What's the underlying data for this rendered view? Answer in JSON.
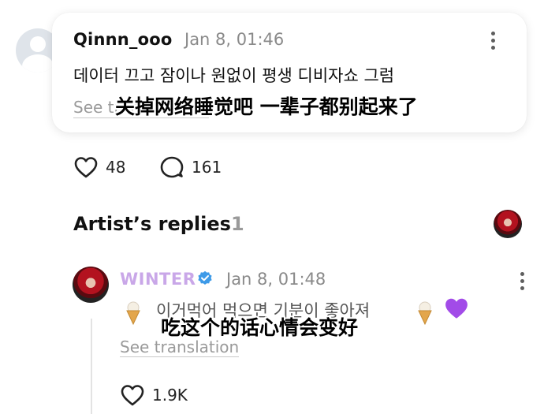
{
  "comment": {
    "username": "Qinnn_ooo",
    "timestamp": "Jan 8, 01:46",
    "text": "데이터 끄고 잠이나 원없이 평생 디비자쇼 그럼",
    "see_translation": "See translation",
    "subtitle": "关掉网络睡觉吧 一辈子都别起来了",
    "likes": "48",
    "comments": "161"
  },
  "artist_replies": {
    "title": "Artist’s replies",
    "count": "1"
  },
  "reply": {
    "name": "WINTER",
    "timestamp": "Jan 8, 01:48",
    "text": "이거먹어 먹으면 기분이 좋아져",
    "subtitle": "吃这个的话心情会变好",
    "see_translation": "See translation",
    "likes": "1.9K",
    "emojis": [
      "ice-cream",
      "ice-cream",
      "purple-heart"
    ],
    "name_color": "#c9a7e8",
    "verified_color": "#3d9ae8"
  }
}
